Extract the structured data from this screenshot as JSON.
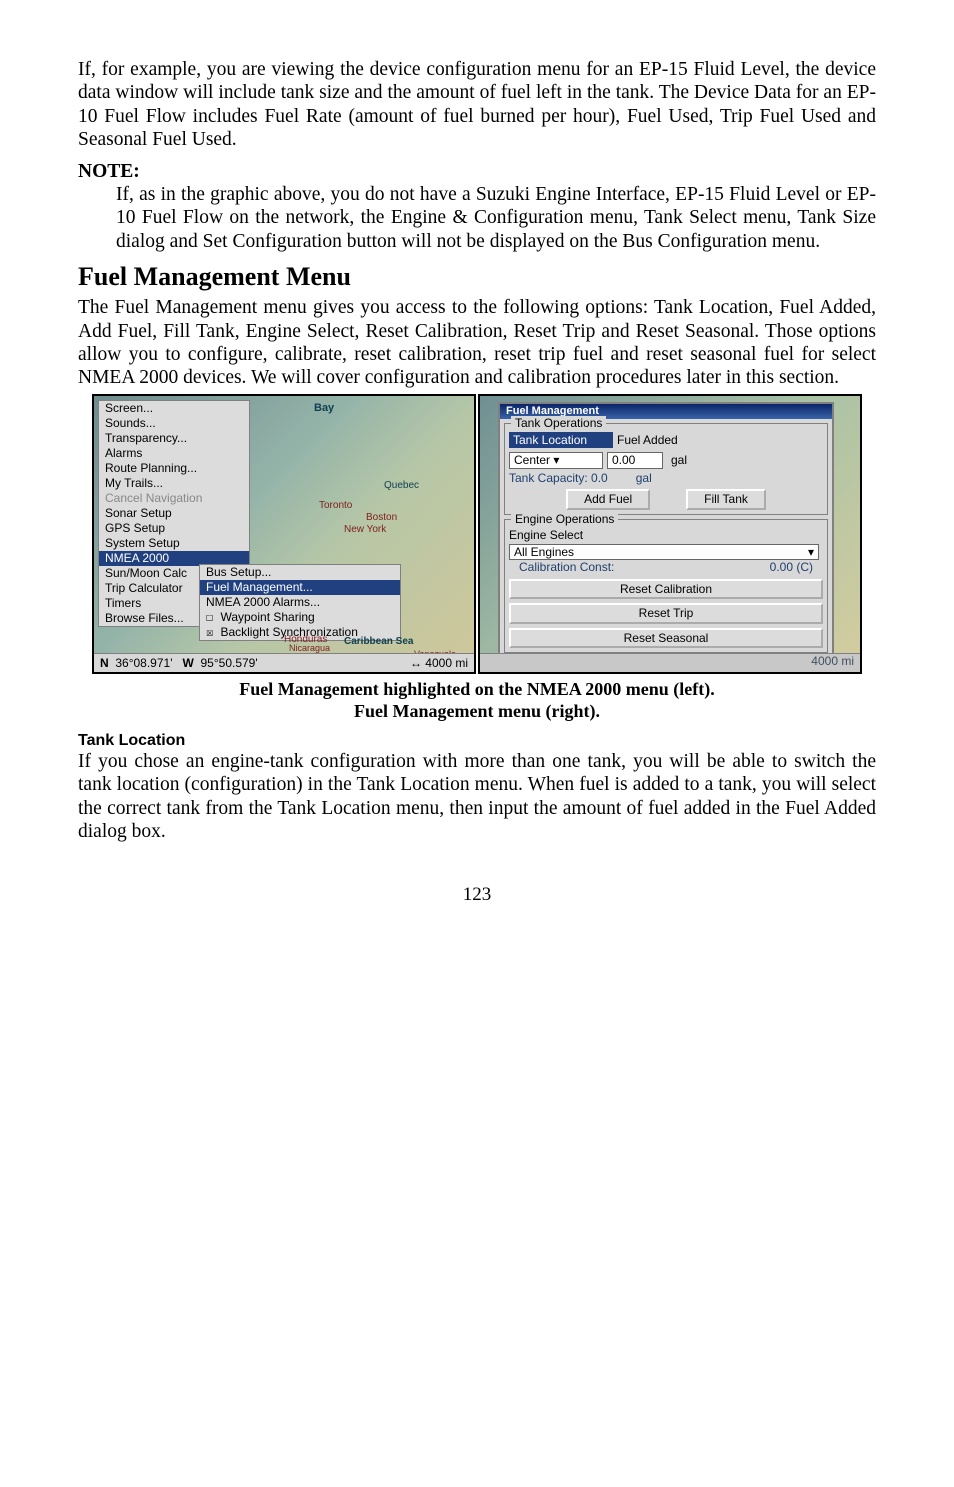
{
  "para1": "If, for example, you are viewing the device configuration menu for an EP-15 Fluid Level, the device data window will include tank size and the amount of fuel left in the tank. The Device Data for an EP-10 Fuel Flow includes Fuel Rate (amount of fuel burned per hour), Fuel Used, Trip Fuel Used and Seasonal Fuel Used.",
  "note_head": "NOTE:",
  "note_body": "If, as in the graphic above, you do not have a Suzuki Engine Interface, EP-15 Fluid Level or EP-10 Fuel Flow on the network, the Engine & Configuration menu, Tank Select menu, Tank Size dialog and Set Configuration button will not be displayed on the Bus Configuration menu.",
  "h2": "Fuel Management Menu",
  "para2": "The Fuel Management menu gives you access to the following options: Tank Location, Fuel Added, Add Fuel, Fill Tank, Engine Select, Reset Calibration, Reset Trip and Reset Seasonal. Those options allow you to configure, calibrate, reset calibration, reset trip fuel and reset seasonal fuel for select NMEA 2000 devices. We will cover configuration and calibration procedures later in this section.",
  "left_menu": {
    "items": [
      "Screen...",
      "Sounds...",
      "Transparency...",
      "Alarms",
      "Route Planning...",
      "My Trails...",
      "Cancel Navigation",
      "Sonar Setup",
      "GPS Setup",
      "System Setup",
      "NMEA 2000",
      "Sun/Moon Calc",
      "Trip Calculator",
      "Timers",
      "Browse Files..."
    ],
    "sub": [
      "Bus Setup...",
      "Fuel Management...",
      "NMEA 2000 Alarms...",
      "Waypoint Sharing",
      "Backlight Synchronization"
    ],
    "map_labels": {
      "bay": "Bay",
      "quebec": "Quebec",
      "toronto": "Toronto",
      "boston": "Boston",
      "newyork": "New York",
      "honduras": "Honduras",
      "nicaragua": "Nicaragua",
      "caribbean": "Caribbean Sea",
      "venezuela": "Venezuela"
    },
    "status": {
      "n": "N",
      "lat": "36°08.971'",
      "w": "W",
      "lon": "95°50.579'",
      "dist": "↔ 4000 mi"
    }
  },
  "right": {
    "title": "Fuel Management",
    "tank_ops": "Tank Operations",
    "tank_loc": "Tank Location",
    "fuel_added": "Fuel Added",
    "center": "Center",
    "zero": "0.00",
    "gal": "gal",
    "cap_lbl": "Tank Capacity: 0.0",
    "cap_unit": "gal",
    "add_fuel": "Add Fuel",
    "fill_tank": "Fill Tank",
    "eng_ops": "Engine Operations",
    "eng_sel": "Engine Select",
    "all_eng": "All Engines",
    "cal_lbl": "Calibration Const:",
    "cal_val": "0.00 (C)",
    "reset_cal": "Reset Calibration",
    "reset_trip": "Reset Trip",
    "reset_seasonal": "Reset Seasonal",
    "status": "4000 mi"
  },
  "caption1": "Fuel Management highlighted on the NMEA 2000 menu (left).",
  "caption2": "Fuel Management menu (right).",
  "tank_head": "Tank Location",
  "para3": "If you chose an engine-tank configuration with more than one tank, you will be able to switch the tank location (configuration) in the Tank Location menu. When fuel is added to a tank, you will select the correct tank from the Tank Location menu, then input the amount of fuel added in the Fuel Added dialog box.",
  "pagenum": "123"
}
